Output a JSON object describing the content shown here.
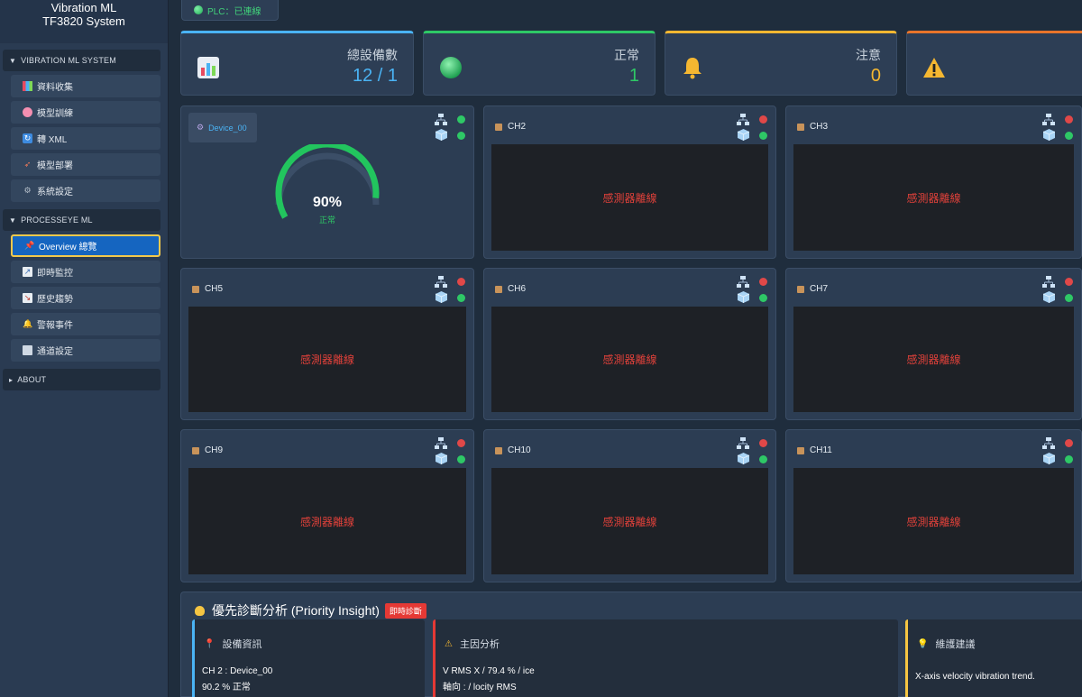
{
  "brand": {
    "line1": "Vibration ML",
    "line2": "TF3820 System"
  },
  "sidebar": {
    "groups": [
      {
        "title": "VIBRATION ML SYSTEM",
        "expanded": true,
        "items": [
          {
            "label": "資料收集",
            "icon": "chart-icon"
          },
          {
            "label": "模型訓練",
            "icon": "brain-icon"
          },
          {
            "label": "轉 XML",
            "icon": "convert-icon"
          },
          {
            "label": "模型部署",
            "icon": "rocket-icon"
          },
          {
            "label": "系統設定",
            "icon": "gear-icon"
          }
        ]
      },
      {
        "title": "PROCESSEYE ML",
        "expanded": true,
        "items": [
          {
            "label": "Overview 總覽",
            "icon": "pin-icon",
            "active": true
          },
          {
            "label": "即時監控",
            "icon": "line-chart-icon"
          },
          {
            "label": "歷史趨勢",
            "icon": "trend-icon"
          },
          {
            "label": "警報事件",
            "icon": "bell-icon"
          },
          {
            "label": "通道設定",
            "icon": "grid-icon"
          }
        ]
      },
      {
        "title": "ABOUT",
        "expanded": false,
        "items": []
      }
    ]
  },
  "plc": {
    "label": "PLC：已連線",
    "color": "#41d17a"
  },
  "stats": [
    {
      "label": "總設備數",
      "value": "12 / 1",
      "icon": "bar-chart-icon",
      "color": "#4ab3f4"
    },
    {
      "label": "正常",
      "value": "1",
      "icon": "green-ball-icon",
      "color": "#2ec866"
    },
    {
      "label": "注意",
      "value": "0",
      "icon": "bell-icon",
      "color": "#f5b731"
    },
    {
      "label": "",
      "value": "",
      "icon": "warning-icon",
      "color": "#e8742a"
    }
  ],
  "device": {
    "name": "Device_00",
    "gauge_percent": 90,
    "gauge_text": "90%",
    "status": "正常"
  },
  "channels": [
    {
      "name": "CH2",
      "message": "感測器離線"
    },
    {
      "name": "CH3",
      "message": "感測器離線"
    },
    {
      "name": "CH5",
      "message": "感測器離線"
    },
    {
      "name": "CH6",
      "message": "感測器離線"
    },
    {
      "name": "CH7",
      "message": "感測器離線"
    },
    {
      "name": "CH9",
      "message": "感測器離線"
    },
    {
      "name": "CH10",
      "message": "感測器離線"
    },
    {
      "name": "CH11",
      "message": "感測器離線"
    }
  ],
  "priority": {
    "title": "優先診斷分析 (Priority Insight)",
    "badge": "即時診斷",
    "panels": [
      {
        "header": "設備資訊",
        "icon": "pin-icon",
        "color": "#4ab3f4",
        "lines": [
          "CH 2 : Device_00",
          "90.2 %   正常"
        ]
      },
      {
        "header": "主因分析",
        "icon": "warning-icon",
        "color": "#e53935",
        "lines": [
          "V RMS X / 79.4 % / ice",
          "軸向 : / locity RMS"
        ]
      },
      {
        "header": "維護建議",
        "icon": "bulb-icon",
        "color": "#f5c542",
        "lines": [
          "X-axis velocity vibration trend."
        ]
      }
    ]
  }
}
